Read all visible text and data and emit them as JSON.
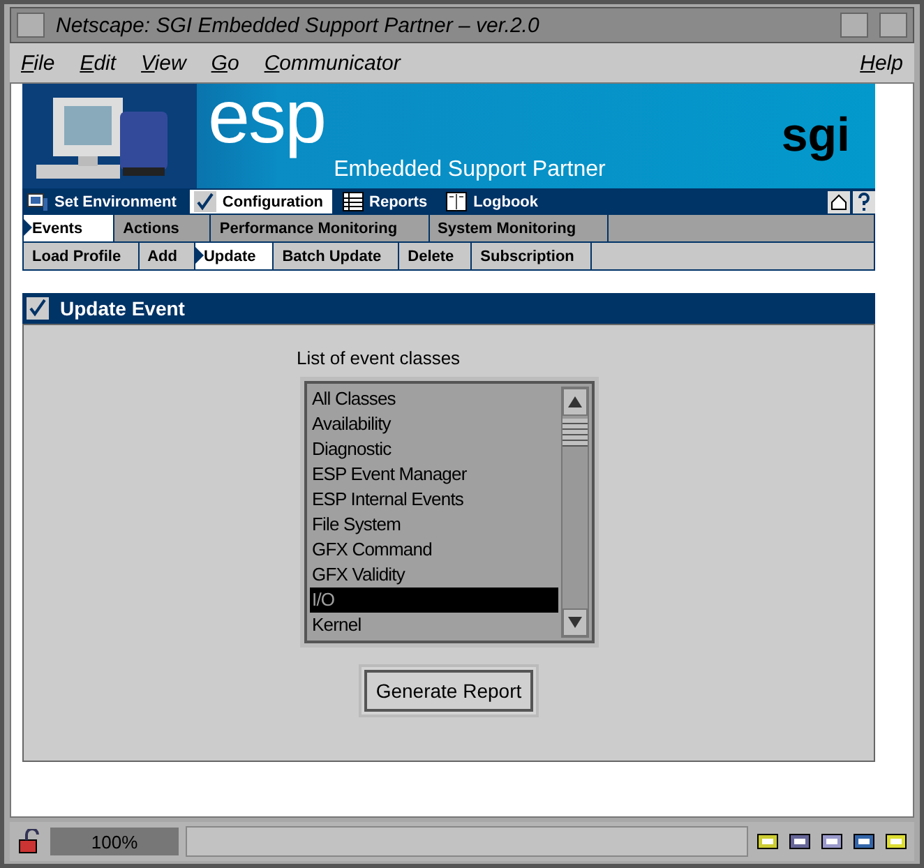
{
  "window": {
    "title": "Netscape: SGI Embedded Support Partner – ver.2.0"
  },
  "menu": [
    {
      "label": "File"
    },
    {
      "label": "Edit"
    },
    {
      "label": "View"
    },
    {
      "label": "Go"
    },
    {
      "label": "Communicator"
    }
  ],
  "help_menu": "Help",
  "banner": {
    "logo": "esp",
    "subtitle": "Embedded Support Partner",
    "brand": "sgi"
  },
  "nav": [
    {
      "label": "Set Environment",
      "selected": false
    },
    {
      "label": "Configuration",
      "selected": true
    },
    {
      "label": "Reports",
      "selected": false
    },
    {
      "label": "Logbook",
      "selected": false
    }
  ],
  "tabs": [
    {
      "label": "Events",
      "selected": true
    },
    {
      "label": "Actions",
      "selected": false
    },
    {
      "label": "Performance Monitoring",
      "selected": false
    },
    {
      "label": "System Monitoring",
      "selected": false
    }
  ],
  "subtabs": [
    {
      "label": "Load Profile",
      "selected": false
    },
    {
      "label": "Add",
      "selected": false
    },
    {
      "label": "Update",
      "selected": true
    },
    {
      "label": "Batch Update",
      "selected": false
    },
    {
      "label": "Delete",
      "selected": false
    },
    {
      "label": "Subscription",
      "selected": false
    }
  ],
  "section": {
    "title": "Update Event"
  },
  "list": {
    "label": "List of event classes",
    "items": [
      {
        "label": "All Classes",
        "selected": false
      },
      {
        "label": "Availability",
        "selected": false
      },
      {
        "label": "Diagnostic",
        "selected": false
      },
      {
        "label": "ESP Event Manager",
        "selected": false
      },
      {
        "label": "ESP Internal Events",
        "selected": false
      },
      {
        "label": "File System",
        "selected": false
      },
      {
        "label": "GFX Command",
        "selected": false
      },
      {
        "label": "GFX Validity",
        "selected": false
      },
      {
        "label": "I/O",
        "selected": true
      },
      {
        "label": "Kernel",
        "selected": false
      }
    ]
  },
  "button": "Generate Report",
  "status_bar": {
    "zoom": "100%"
  }
}
